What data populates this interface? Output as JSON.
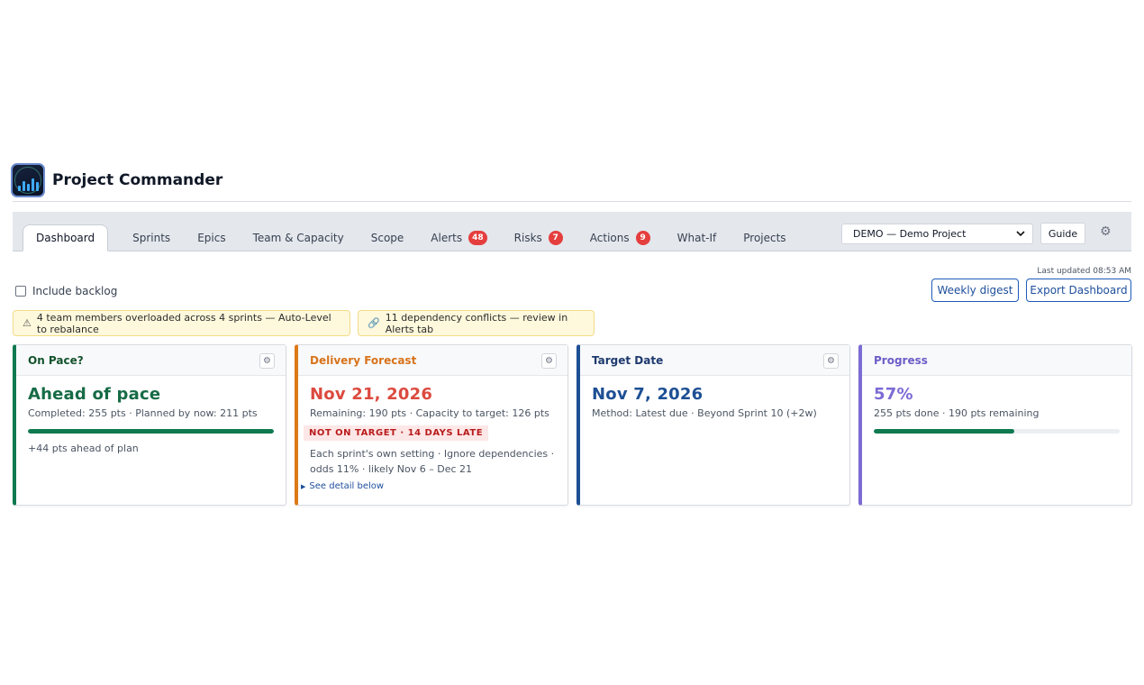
{
  "app": {
    "title": "Project Commander"
  },
  "tabs": [
    {
      "label": "Dashboard",
      "active": true
    },
    {
      "label": "Sprints"
    },
    {
      "label": "Epics"
    },
    {
      "label": "Team & Capacity"
    },
    {
      "label": "Scope"
    },
    {
      "label": "Alerts",
      "badge": "48"
    },
    {
      "label": "Risks",
      "badge": "7"
    },
    {
      "label": "Actions",
      "badge": "9"
    },
    {
      "label": "What-If"
    },
    {
      "label": "Projects"
    }
  ],
  "project_select": {
    "value": "DEMO — Demo Project"
  },
  "guide_label": "Guide",
  "last_updated": "Last updated 08:53 AM",
  "include_backlog_label": "Include backlog",
  "buttons": {
    "weekly_digest": "Weekly digest",
    "export": "Export Dashboard"
  },
  "banners": [
    {
      "icon": "warning-icon",
      "text": "4 team members overloaded across 4 sprints — Auto-Level to rebalance"
    },
    {
      "icon": "link-icon",
      "text": "11 dependency conflicts — review in Alerts tab"
    }
  ],
  "cards": {
    "pace": {
      "title": "On Pace?",
      "headline": "Ahead of pace",
      "detail": "Completed: 255 pts · Planned by now: 211 pts",
      "progress": 1.0,
      "note": "+44 pts ahead of plan",
      "accent": "#0f7a50"
    },
    "forecast": {
      "title": "Delivery Forecast",
      "headline": "Nov 21, 2026",
      "detail": "Remaining: 190 pts · Capacity to target: 126 pts",
      "tag": "NOT ON TARGET · 14 DAYS LATE",
      "extra": "Each sprint's own setting · Ignore dependencies · odds 11% · likely Nov 6 – Dec 21",
      "link": "See detail below",
      "accent": "#dd7a18"
    },
    "target": {
      "title": "Target Date",
      "headline": "Nov 7, 2026",
      "detail": "Method: Latest due · Beyond Sprint 10 (+2w)",
      "accent": "#1d4f94"
    },
    "progress": {
      "title": "Progress",
      "headline": "57%",
      "detail": "255 pts done · 190 pts remaining",
      "progress": 0.57,
      "accent": "#7c6cd4"
    }
  }
}
